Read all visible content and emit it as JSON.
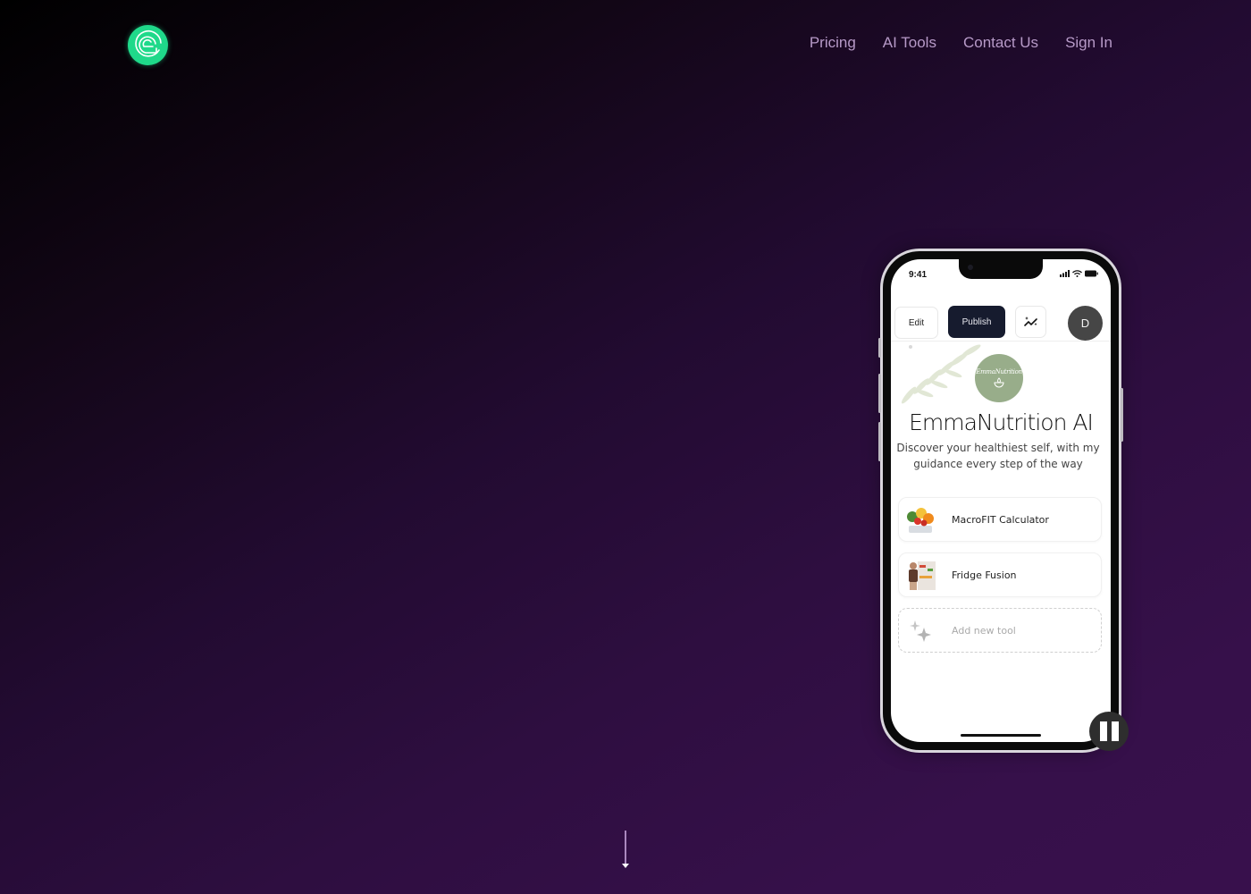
{
  "header": {
    "logo": {
      "icon": "spiral-logo-icon",
      "color": "#1fd98a"
    },
    "nav": [
      {
        "label": "Pricing"
      },
      {
        "label": "AI Tools"
      },
      {
        "label": "Contact Us"
      },
      {
        "label": "Sign In"
      }
    ]
  },
  "phone": {
    "status_bar": {
      "time": "9:41",
      "icons": [
        "signal-icon",
        "wifi-icon",
        "battery-icon"
      ]
    },
    "toolbar": {
      "edit_label": "Edit",
      "publish_label": "Publish",
      "magic_icon": "sparkle-chart-icon",
      "avatar_initial": "D"
    },
    "profile": {
      "logo_text": "EmmaNutrition",
      "logo_icon": "lotus-bowl-icon",
      "logo_color": "#98ad8a",
      "name": "EmmaNutrition AI",
      "bio": "Discover your healthiest self, with my guidance every step of the way"
    },
    "tools": [
      {
        "label": "MacroFIT Calculator",
        "thumb": "food-scale-image"
      },
      {
        "label": "Fridge Fusion",
        "thumb": "person-fridge-image"
      }
    ],
    "add_tool_label": "Add new tool"
  },
  "video_controls": {
    "pause_icon": "pause-icon"
  },
  "scroll_indicator": {
    "icon": "arrow-down-icon"
  },
  "colors": {
    "background_start": "#000000",
    "background_end": "#36104a",
    "nav_text": "#b79ac8",
    "publish_bg": "#161b2e"
  }
}
